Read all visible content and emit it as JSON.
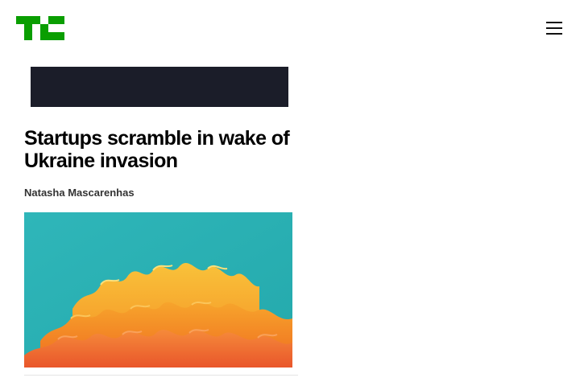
{
  "header": {
    "logo_text": "TC",
    "logo_color": "#0a9e01",
    "menu_icon": "hamburger-menu-icon"
  },
  "ad": {
    "background": "#1b1d29"
  },
  "article": {
    "headline": "Startups scramble in wake of Ukraine invasion",
    "author": "Natasha Mascarenhas",
    "image_icon": "abstract-paper-waves-image"
  }
}
